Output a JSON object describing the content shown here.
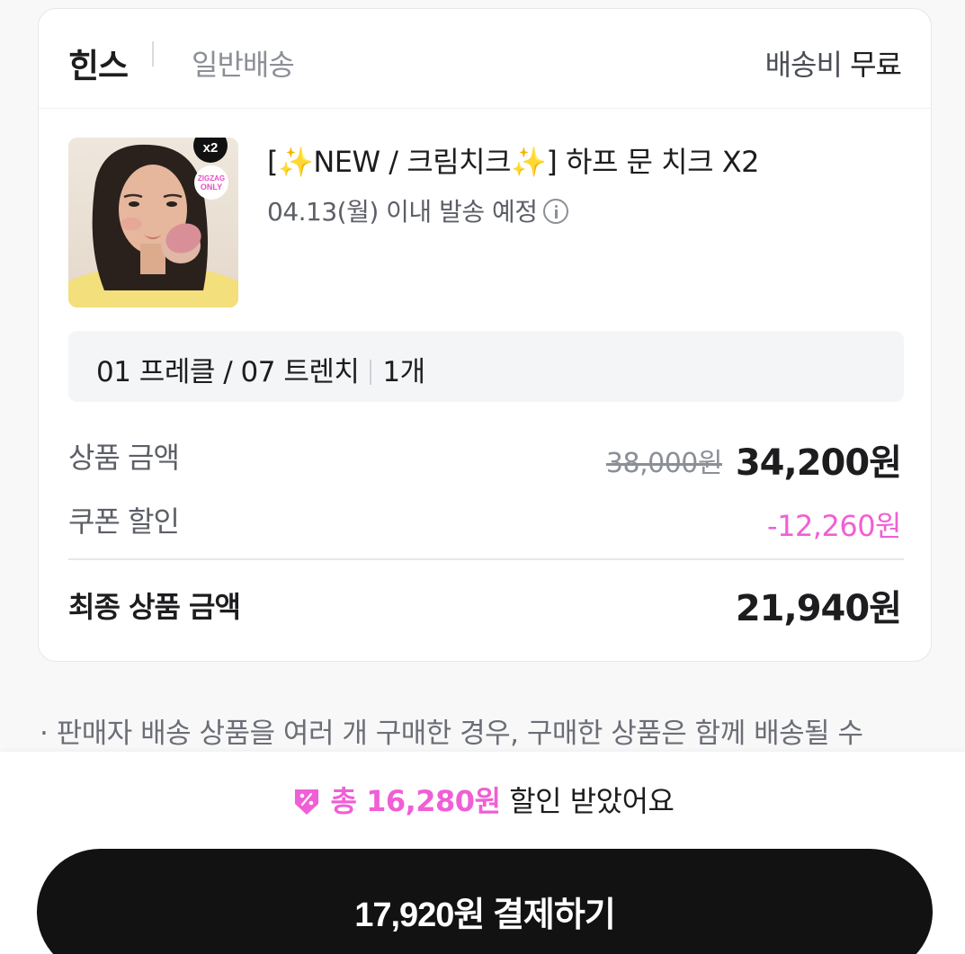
{
  "seller": {
    "name": "힌스",
    "shipping_type": "일반배송",
    "shipping_fee_label": "배송비",
    "shipping_fee_value": "무료"
  },
  "product": {
    "title": "[✨NEW / 크림치크✨] 하프 문 치크 X2",
    "ship_date": "04.13(월) 이내 발송 예정",
    "thumbnail_badge": "x2",
    "thumbnail_sticker_line1": "ZIGZAG",
    "thumbnail_sticker_line2": "ONLY",
    "option": "01 프레클 / 07 트렌치",
    "quantity": "1개"
  },
  "price": {
    "product_amount_label": "상품 금액",
    "original_price": "38,000원",
    "sale_price": "34,200원",
    "coupon_label": "쿠폰 할인",
    "coupon_discount": "-12,260원",
    "final_label": "최종 상품 금액",
    "final_price": "21,940원"
  },
  "notice": "· 판매자 배송 상품을 여러 개 구매한 경우, 구매한 상품은 함께 배송될 수",
  "footer": {
    "discount_prefix": "총 16,280원",
    "discount_suffix": " 할인 받았어요",
    "pay_button_label": "17,920원 결제하기"
  },
  "colors": {
    "accent_pink": "#f05fd5",
    "button_black": "#121212"
  }
}
